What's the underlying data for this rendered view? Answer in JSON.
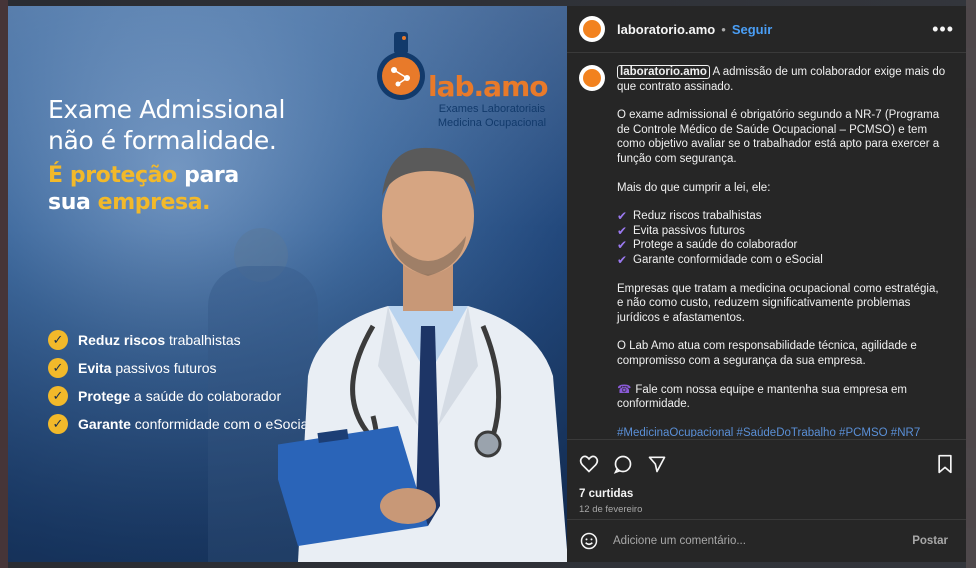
{
  "image": {
    "brand": "lab.amo",
    "brand_sub_1": "Exames Laboratoriais",
    "brand_sub_2": "Medicina Ocupacional",
    "headline_line1": "Exame Admissional",
    "headline_line2": "não é formalidade.",
    "headline2_yellow": "É proteção",
    "headline2_white": " para",
    "headline3_white": "sua ",
    "headline3_yellow": "empresa.",
    "checklist": [
      {
        "bold": "Reduz riscos",
        "rest": " trabalhistas"
      },
      {
        "bold": "Evita",
        "rest": " passivos futuros"
      },
      {
        "bold": "Protege",
        "rest": " a saúde do colaborador"
      },
      {
        "bold": "Garante",
        "rest": " conformidade com o eSocial"
      }
    ],
    "colors": {
      "accent_yellow": "#f2b92a",
      "brand_orange": "#e87a2a",
      "brand_navy": "#123a6b"
    }
  },
  "header": {
    "username": "laboratorio.amo",
    "separator": "•",
    "follow": "Seguir",
    "more_icon": "more-horizontal-icon"
  },
  "caption": {
    "username": "laboratorio.amo",
    "intro": "A admissão de um colaborador exige mais do que contrato assinado.",
    "p1": "O exame admissional é obrigatório segundo a NR-7 (Programa de Controle Médico de Saúde Ocupacional – PCMSO) e tem como objetivo avaliar se o trabalhador está apto para exercer a função com segurança.",
    "p2": "Mais do que cumprir a lei, ele:",
    "list": [
      "Reduz riscos trabalhistas",
      "Evita passivos futuros",
      "Protege a saúde do colaborador",
      "Garante conformidade com o eSocial"
    ],
    "p3": "Empresas que tratam a medicina ocupacional como estratégia, e não como custo, reduzem significativamente problemas jurídicos e afastamentos.",
    "p4": "O Lab Amo atua com responsabilidade técnica, agilidade e compromisso com a segurança da sua empresa.",
    "p5": "Fale com nossa equipe e mantenha sua empresa em conformidade.",
    "hashtags": "#MedicinaOcupacional #SaúdeDoTrabalho #PCMSO #NR7"
  },
  "actions": {
    "likes": "7 curtidas",
    "date": "12 de fevereiro"
  },
  "comment": {
    "placeholder": "Adicione um comentário...",
    "post": "Postar"
  }
}
